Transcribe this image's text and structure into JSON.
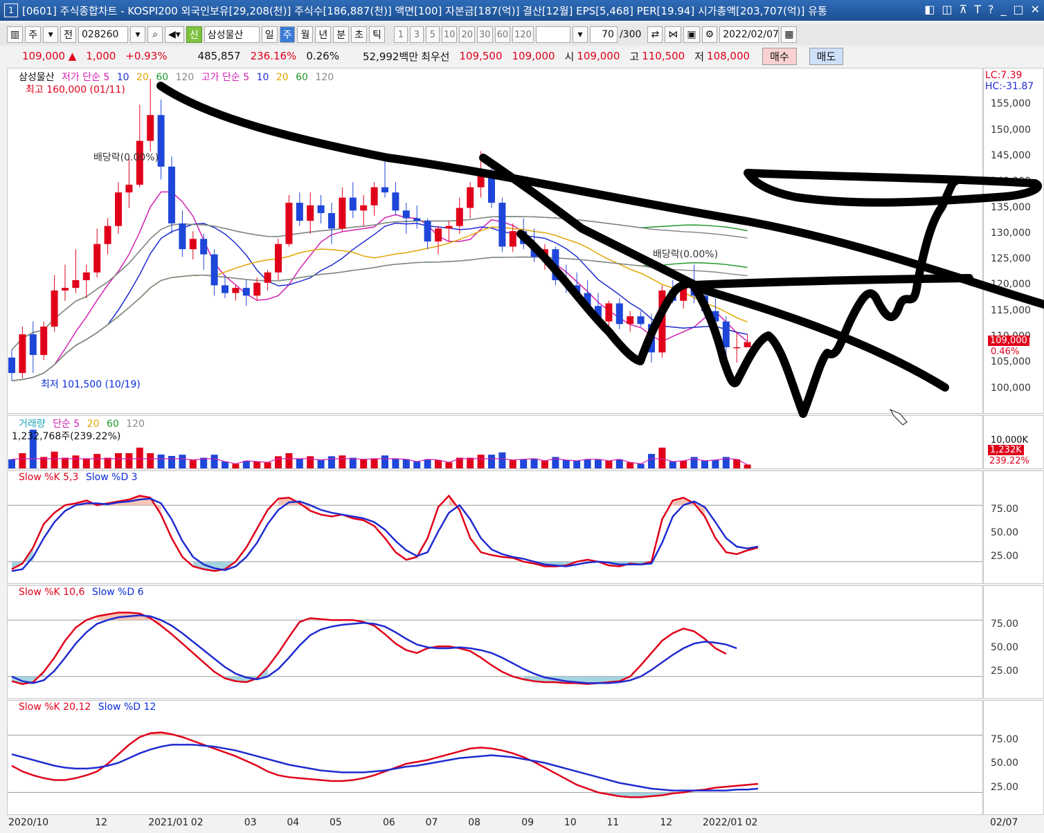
{
  "titlebar": {
    "text": "[0601] 주식종합차트 - KOSPI200 외국인보유[29,208(천)] 주식수[186,887(천)] 액면[100] 자본금[187(억)] 결산[12월] EPS[5,468] PER[19.94] 시가총액[203,707(억)] 유통",
    "window_number": "1",
    "controls": [
      "◧",
      "◫",
      "⊼",
      "T",
      "?",
      "_",
      "□",
      "✕"
    ]
  },
  "toolbar": {
    "period_label": "주",
    "prev_label": "전",
    "code": "028260",
    "new_badge": "신",
    "name": "삼성물산",
    "intervals": [
      "일",
      "주",
      "월",
      "년",
      "분",
      "초",
      "틱"
    ],
    "selected_interval": "주",
    "numbers": [
      "1",
      "3",
      "5",
      "10",
      "20",
      "30",
      "60",
      "120"
    ],
    "count": "70",
    "count_total": "/300",
    "date": "2022/02/07"
  },
  "quote": {
    "price": "109,000 ▲",
    "change": "1,000",
    "change_pct": "+0.93%",
    "volume": "485,857",
    "vol_ratio": "236.16%",
    "turnover": "0.26%",
    "amount": "52,992백만",
    "best": "최우선",
    "ask": "109,500",
    "bid": "109,000",
    "open_label": "시",
    "open": "109,000",
    "high_label": "고",
    "high": "110,500",
    "low_label": "저",
    "low": "108,000",
    "buy": "매수",
    "sell": "매도"
  },
  "price_panel": {
    "label_name": "삼성물산",
    "label_low": "저가 단순 5",
    "label_low_p": [
      "10",
      "20",
      "60",
      "120"
    ],
    "label_high": "고가 단순 5",
    "label_high_p": [
      "10",
      "20",
      "60",
      "120"
    ],
    "max_note": "최고 160,000 (01/11)",
    "min_note": "최저 101,500 (10/19)",
    "div_note1": "배당락(0.00%)",
    "div_note2": "배당락(0.00%)",
    "lc": "LC:7.39",
    "hc": "HC:-31.87",
    "price_tag": "109,000",
    "pct_tag": "0.46%",
    "yticks": [
      "155,000",
      "150,000",
      "145,000",
      "140,000",
      "135,000",
      "130,000",
      "125,000",
      "120,000",
      "115,000",
      "110,000",
      "105,000",
      "100,000"
    ]
  },
  "volume_panel": {
    "label": "거래량",
    "label_ma": "단순 5",
    "label_ma_p": [
      "20",
      "60",
      "120"
    ],
    "value": "1,232,768주(239.22%)",
    "ytick": "10,000K",
    "tag1": "1,232K",
    "tag2": "239.22%"
  },
  "stoch1": {
    "k": "Slow %K 5,3",
    "d": "Slow %D 3",
    "yticks": [
      "75.00",
      "50.00",
      "25.00"
    ]
  },
  "stoch2": {
    "k": "Slow %K 10,6",
    "d": "Slow %D 6",
    "yticks": [
      "75.00",
      "50.00",
      "25.00"
    ]
  },
  "stoch3": {
    "k": "Slow %K 20,12",
    "d": "Slow %D 12",
    "yticks": [
      "75.00",
      "50.00",
      "25.00"
    ]
  },
  "xaxis": [
    "2020/10",
    "12",
    "2021/01",
    "02",
    "03",
    "04",
    "05",
    "06",
    "07",
    "08",
    "09",
    "10",
    "11",
    "12",
    "2022/01",
    "02"
  ],
  "xaxis_right": "02/07",
  "colors": {
    "up": "#e0001a",
    "down": "#1e46d8",
    "k": "#e0001a",
    "d": "#1e2bd0"
  },
  "chart_data": {
    "type": "candlestick",
    "unit": "KRW",
    "x": [
      "2020/10/05",
      "2020/10/12",
      "2020/10/19",
      "2020/10/26",
      "2020/11/02",
      "2020/11/09",
      "2020/11/16",
      "2020/11/23",
      "2020/11/30",
      "2020/12/07",
      "2020/12/14",
      "2020/12/21",
      "2020/12/28",
      "2021/01/04",
      "2021/01/11",
      "2021/01/18",
      "2021/01/25",
      "2021/02/01",
      "2021/02/08",
      "2021/02/15",
      "2021/02/22",
      "2021/03/01",
      "2021/03/08",
      "2021/03/15",
      "2021/03/22",
      "2021/03/29",
      "2021/04/05",
      "2021/04/12",
      "2021/04/19",
      "2021/04/26",
      "2021/05/03",
      "2021/05/10",
      "2021/05/17",
      "2021/05/24",
      "2021/05/31",
      "2021/06/07",
      "2021/06/14",
      "2021/06/21",
      "2021/06/28",
      "2021/07/05",
      "2021/07/12",
      "2021/07/19",
      "2021/07/26",
      "2021/08/02",
      "2021/08/09",
      "2021/08/16",
      "2021/08/23",
      "2021/08/30",
      "2021/09/06",
      "2021/09/13",
      "2021/09/20",
      "2021/09/27",
      "2021/10/04",
      "2021/10/11",
      "2021/10/18",
      "2021/10/25",
      "2021/11/01",
      "2021/11/08",
      "2021/11/15",
      "2021/11/22",
      "2021/11/29",
      "2021/12/06",
      "2021/12/13",
      "2021/12/20",
      "2021/12/27",
      "2022/01/03",
      "2022/01/10",
      "2022/01/17",
      "2022/01/24",
      "2022/02/07"
    ],
    "ohlc": [
      [
        106000,
        107500,
        101500,
        103000
      ],
      [
        103000,
        112000,
        102000,
        110500
      ],
      [
        110500,
        113000,
        103000,
        106500
      ],
      [
        106500,
        113000,
        105500,
        112000
      ],
      [
        112000,
        122000,
        111000,
        119000
      ],
      [
        119000,
        124000,
        117000,
        119500
      ],
      [
        119500,
        127000,
        118500,
        121000
      ],
      [
        121000,
        124000,
        117500,
        122500
      ],
      [
        122500,
        131000,
        121500,
        128000
      ],
      [
        128000,
        133000,
        126000,
        131500
      ],
      [
        131500,
        140000,
        130000,
        138000
      ],
      [
        138000,
        145000,
        135000,
        139500
      ],
      [
        139500,
        155000,
        139000,
        148000
      ],
      [
        148000,
        160000,
        146000,
        153000
      ],
      [
        153000,
        156000,
        140500,
        143000
      ],
      [
        143000,
        145000,
        130000,
        132000
      ],
      [
        132000,
        134500,
        125500,
        127000
      ],
      [
        127000,
        130500,
        125000,
        129000
      ],
      [
        129000,
        130000,
        123000,
        126000
      ],
      [
        126000,
        127000,
        118000,
        120000
      ],
      [
        120000,
        122000,
        117500,
        118500
      ],
      [
        118500,
        120000,
        117000,
        119500
      ],
      [
        119500,
        121000,
        116000,
        118000
      ],
      [
        118000,
        121500,
        117000,
        120500
      ],
      [
        120500,
        123000,
        119000,
        122500
      ],
      [
        122500,
        129000,
        121000,
        128000
      ],
      [
        128000,
        137500,
        127500,
        136000
      ],
      [
        136000,
        138000,
        131500,
        132500
      ],
      [
        132500,
        138000,
        130000,
        135500
      ],
      [
        135500,
        137500,
        132000,
        134000
      ],
      [
        134000,
        136000,
        128000,
        131000
      ],
      [
        131000,
        139000,
        130500,
        137000
      ],
      [
        137000,
        140000,
        133000,
        134500
      ],
      [
        134500,
        137500,
        131500,
        135500
      ],
      [
        135500,
        140000,
        133500,
        139000
      ],
      [
        139000,
        145500,
        137000,
        138000
      ],
      [
        138000,
        140000,
        133500,
        134500
      ],
      [
        134500,
        136000,
        130000,
        133000
      ],
      [
        133000,
        135500,
        131000,
        132500
      ],
      [
        132500,
        133000,
        127000,
        128500
      ],
      [
        128500,
        131500,
        126000,
        131000
      ],
      [
        131000,
        132500,
        128500,
        131500
      ],
      [
        131500,
        137000,
        130000,
        135000
      ],
      [
        135000,
        140000,
        133000,
        139000
      ],
      [
        139000,
        146000,
        137000,
        141500
      ],
      [
        141500,
        144000,
        135000,
        136000
      ],
      [
        136000,
        137000,
        126500,
        127500
      ],
      [
        127500,
        132000,
        126500,
        130500
      ],
      [
        130500,
        133000,
        127000,
        128000
      ],
      [
        128000,
        131000,
        124500,
        125500
      ],
      [
        125500,
        128000,
        123000,
        127000
      ],
      [
        127000,
        127500,
        120000,
        121000
      ],
      [
        121000,
        124000,
        118500,
        120000
      ],
      [
        120000,
        122500,
        117500,
        118500
      ],
      [
        118500,
        121000,
        115000,
        116000
      ],
      [
        116000,
        118500,
        112500,
        113000
      ],
      [
        113000,
        117000,
        112000,
        116500
      ],
      [
        116500,
        117500,
        111500,
        112500
      ],
      [
        112500,
        115000,
        111000,
        114000
      ],
      [
        114000,
        115000,
        112000,
        112500
      ],
      [
        112500,
        114500,
        105000,
        107000
      ],
      [
        107000,
        120000,
        106000,
        119000
      ],
      [
        119000,
        121000,
        116500,
        117000
      ],
      [
        117000,
        120500,
        115500,
        120000
      ],
      [
        120000,
        124000,
        116500,
        118000
      ],
      [
        118000,
        119000,
        114000,
        115000
      ],
      [
        115000,
        117500,
        112000,
        113000
      ],
      [
        113000,
        114000,
        106500,
        108000
      ],
      [
        108000,
        111000,
        105000,
        108000
      ],
      [
        108000,
        110500,
        108000,
        109000
      ]
    ],
    "volume_last": 1232768,
    "y_range": [
      95000,
      160000
    ],
    "series": [
      {
        "name": "Slow %K 5,3",
        "values": [
          12,
          18,
          35,
          60,
          72,
          80,
          82,
          85,
          80,
          82,
          84,
          86,
          90,
          88,
          70,
          45,
          25,
          15,
          12,
          10,
          12,
          20,
          35,
          55,
          75,
          87,
          88,
          82,
          74,
          70,
          68,
          70,
          66,
          64,
          58,
          45,
          30,
          22,
          25,
          45,
          78,
          90,
          75,
          45,
          30,
          27,
          25,
          24,
          20,
          18,
          15,
          15,
          16,
          20,
          22,
          20,
          16,
          15,
          18,
          17,
          20,
          65,
          85,
          88,
          82,
          68,
          45,
          30,
          28,
          32,
          35
        ]
      },
      {
        "name": "Slow %D 3",
        "values": [
          10,
          12,
          25,
          45,
          62,
          74,
          80,
          82,
          82,
          81,
          83,
          84,
          86,
          87,
          82,
          65,
          42,
          25,
          17,
          13,
          11,
          15,
          25,
          40,
          60,
          75,
          83,
          84,
          80,
          75,
          72,
          70,
          68,
          66,
          62,
          54,
          42,
          32,
          26,
          30,
          52,
          72,
          80,
          65,
          45,
          33,
          28,
          25,
          23,
          20,
          17,
          16,
          15,
          17,
          19,
          20,
          19,
          17,
          17,
          17,
          18,
          40,
          68,
          80,
          84,
          78,
          62,
          45,
          36,
          34,
          36
        ]
      },
      {
        "name": "Slow %K 10,6",
        "values": [
          15,
          12,
          14,
          25,
          40,
          58,
          72,
          80,
          84,
          86,
          88,
          88,
          87,
          82,
          74,
          65,
          55,
          45,
          35,
          25,
          18,
          15,
          14,
          18,
          30,
          45,
          62,
          78,
          82,
          81,
          80,
          80,
          80,
          78,
          74,
          65,
          55,
          48,
          45,
          50,
          52,
          52,
          50,
          47,
          40,
          32,
          25,
          20,
          17,
          15,
          14,
          14,
          13,
          13,
          12,
          13,
          14,
          15,
          20,
          32,
          45,
          58,
          66,
          71,
          68,
          60,
          50,
          44
        ]
      },
      {
        "name": "Slow %D 6",
        "values": [
          20,
          15,
          13,
          16,
          26,
          40,
          55,
          67,
          76,
          80,
          83,
          84,
          85,
          84,
          80,
          74,
          66,
          57,
          48,
          39,
          30,
          23,
          19,
          17,
          20,
          28,
          40,
          53,
          64,
          70,
          73,
          75,
          76,
          77,
          76,
          73,
          67,
          60,
          54,
          51,
          50,
          50,
          51,
          50,
          48,
          45,
          40,
          34,
          28,
          23,
          19,
          17,
          15,
          14,
          13,
          13,
          13,
          14,
          16,
          20,
          27,
          35,
          43,
          50,
          55,
          57,
          56,
          54,
          50
        ]
      },
      {
        "name": "Slow %K 20,12",
        "values": [
          48,
          42,
          38,
          35,
          33,
          33,
          35,
          38,
          42,
          50,
          60,
          70,
          78,
          82,
          83,
          81,
          78,
          74,
          70,
          66,
          62,
          58,
          53,
          48,
          42,
          38,
          36,
          35,
          34,
          33,
          32,
          32,
          33,
          35,
          38,
          42,
          46,
          50,
          52,
          54,
          57,
          60,
          63,
          66,
          67,
          66,
          64,
          61,
          57,
          52,
          46,
          40,
          34,
          28,
          24,
          20,
          18,
          16,
          15,
          15,
          16,
          17,
          19,
          20,
          22,
          23,
          25,
          26,
          27,
          28,
          29
        ]
      },
      {
        "name": "Slow %D 12",
        "values": [
          60,
          57,
          54,
          51,
          48,
          46,
          45,
          45,
          46,
          48,
          51,
          56,
          61,
          65,
          68,
          70,
          70,
          70,
          69,
          68,
          66,
          64,
          61,
          58,
          55,
          52,
          49,
          47,
          45,
          43,
          42,
          41,
          41,
          41,
          42,
          43,
          45,
          47,
          48,
          50,
          52,
          54,
          56,
          57,
          58,
          59,
          58,
          57,
          55,
          53,
          51,
          48,
          45,
          42,
          39,
          36,
          33,
          30,
          28,
          26,
          24,
          23,
          22,
          22,
          22,
          22,
          22,
          22,
          23,
          23,
          24
        ]
      }
    ]
  }
}
